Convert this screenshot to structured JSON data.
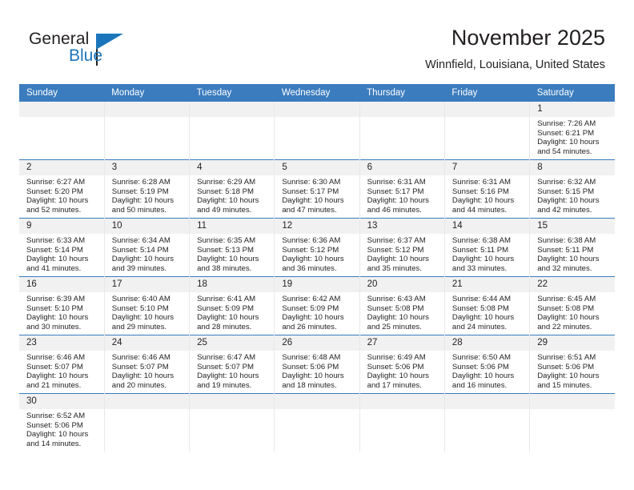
{
  "brand": {
    "name_top": "General",
    "name_bottom": "Blue",
    "accent_color": "#1b75bb",
    "triangle_icon": "triangle-logo-icon"
  },
  "header": {
    "title": "November 2025",
    "subtitle": "Winnfield, Louisiana, United States"
  },
  "calendar": {
    "header_bg": "#3b7cbe",
    "daynum_bg": "#f1f1f1",
    "weekdays": [
      "Sunday",
      "Monday",
      "Tuesday",
      "Wednesday",
      "Thursday",
      "Friday",
      "Saturday"
    ],
    "labels": {
      "sunrise": "Sunrise:",
      "sunset": "Sunset:",
      "daylight": "Daylight:"
    },
    "weeks": [
      [
        {
          "day": "",
          "empty": true
        },
        {
          "day": "",
          "empty": true
        },
        {
          "day": "",
          "empty": true
        },
        {
          "day": "",
          "empty": true
        },
        {
          "day": "",
          "empty": true
        },
        {
          "day": "",
          "empty": true
        },
        {
          "day": "1",
          "sunrise": "Sunrise: 7:26 AM",
          "sunset": "Sunset: 6:21 PM",
          "daylight_1": "Daylight: 10 hours",
          "daylight_2": "and 54 minutes."
        }
      ],
      [
        {
          "day": "2",
          "sunrise": "Sunrise: 6:27 AM",
          "sunset": "Sunset: 5:20 PM",
          "daylight_1": "Daylight: 10 hours",
          "daylight_2": "and 52 minutes."
        },
        {
          "day": "3",
          "sunrise": "Sunrise: 6:28 AM",
          "sunset": "Sunset: 5:19 PM",
          "daylight_1": "Daylight: 10 hours",
          "daylight_2": "and 50 minutes."
        },
        {
          "day": "4",
          "sunrise": "Sunrise: 6:29 AM",
          "sunset": "Sunset: 5:18 PM",
          "daylight_1": "Daylight: 10 hours",
          "daylight_2": "and 49 minutes."
        },
        {
          "day": "5",
          "sunrise": "Sunrise: 6:30 AM",
          "sunset": "Sunset: 5:17 PM",
          "daylight_1": "Daylight: 10 hours",
          "daylight_2": "and 47 minutes."
        },
        {
          "day": "6",
          "sunrise": "Sunrise: 6:31 AM",
          "sunset": "Sunset: 5:17 PM",
          "daylight_1": "Daylight: 10 hours",
          "daylight_2": "and 46 minutes."
        },
        {
          "day": "7",
          "sunrise": "Sunrise: 6:31 AM",
          "sunset": "Sunset: 5:16 PM",
          "daylight_1": "Daylight: 10 hours",
          "daylight_2": "and 44 minutes."
        },
        {
          "day": "8",
          "sunrise": "Sunrise: 6:32 AM",
          "sunset": "Sunset: 5:15 PM",
          "daylight_1": "Daylight: 10 hours",
          "daylight_2": "and 42 minutes."
        }
      ],
      [
        {
          "day": "9",
          "sunrise": "Sunrise: 6:33 AM",
          "sunset": "Sunset: 5:14 PM",
          "daylight_1": "Daylight: 10 hours",
          "daylight_2": "and 41 minutes."
        },
        {
          "day": "10",
          "sunrise": "Sunrise: 6:34 AM",
          "sunset": "Sunset: 5:14 PM",
          "daylight_1": "Daylight: 10 hours",
          "daylight_2": "and 39 minutes."
        },
        {
          "day": "11",
          "sunrise": "Sunrise: 6:35 AM",
          "sunset": "Sunset: 5:13 PM",
          "daylight_1": "Daylight: 10 hours",
          "daylight_2": "and 38 minutes."
        },
        {
          "day": "12",
          "sunrise": "Sunrise: 6:36 AM",
          "sunset": "Sunset: 5:12 PM",
          "daylight_1": "Daylight: 10 hours",
          "daylight_2": "and 36 minutes."
        },
        {
          "day": "13",
          "sunrise": "Sunrise: 6:37 AM",
          "sunset": "Sunset: 5:12 PM",
          "daylight_1": "Daylight: 10 hours",
          "daylight_2": "and 35 minutes."
        },
        {
          "day": "14",
          "sunrise": "Sunrise: 6:38 AM",
          "sunset": "Sunset: 5:11 PM",
          "daylight_1": "Daylight: 10 hours",
          "daylight_2": "and 33 minutes."
        },
        {
          "day": "15",
          "sunrise": "Sunrise: 6:38 AM",
          "sunset": "Sunset: 5:11 PM",
          "daylight_1": "Daylight: 10 hours",
          "daylight_2": "and 32 minutes."
        }
      ],
      [
        {
          "day": "16",
          "sunrise": "Sunrise: 6:39 AM",
          "sunset": "Sunset: 5:10 PM",
          "daylight_1": "Daylight: 10 hours",
          "daylight_2": "and 30 minutes."
        },
        {
          "day": "17",
          "sunrise": "Sunrise: 6:40 AM",
          "sunset": "Sunset: 5:10 PM",
          "daylight_1": "Daylight: 10 hours",
          "daylight_2": "and 29 minutes."
        },
        {
          "day": "18",
          "sunrise": "Sunrise: 6:41 AM",
          "sunset": "Sunset: 5:09 PM",
          "daylight_1": "Daylight: 10 hours",
          "daylight_2": "and 28 minutes."
        },
        {
          "day": "19",
          "sunrise": "Sunrise: 6:42 AM",
          "sunset": "Sunset: 5:09 PM",
          "daylight_1": "Daylight: 10 hours",
          "daylight_2": "and 26 minutes."
        },
        {
          "day": "20",
          "sunrise": "Sunrise: 6:43 AM",
          "sunset": "Sunset: 5:08 PM",
          "daylight_1": "Daylight: 10 hours",
          "daylight_2": "and 25 minutes."
        },
        {
          "day": "21",
          "sunrise": "Sunrise: 6:44 AM",
          "sunset": "Sunset: 5:08 PM",
          "daylight_1": "Daylight: 10 hours",
          "daylight_2": "and 24 minutes."
        },
        {
          "day": "22",
          "sunrise": "Sunrise: 6:45 AM",
          "sunset": "Sunset: 5:08 PM",
          "daylight_1": "Daylight: 10 hours",
          "daylight_2": "and 22 minutes."
        }
      ],
      [
        {
          "day": "23",
          "sunrise": "Sunrise: 6:46 AM",
          "sunset": "Sunset: 5:07 PM",
          "daylight_1": "Daylight: 10 hours",
          "daylight_2": "and 21 minutes."
        },
        {
          "day": "24",
          "sunrise": "Sunrise: 6:46 AM",
          "sunset": "Sunset: 5:07 PM",
          "daylight_1": "Daylight: 10 hours",
          "daylight_2": "and 20 minutes."
        },
        {
          "day": "25",
          "sunrise": "Sunrise: 6:47 AM",
          "sunset": "Sunset: 5:07 PM",
          "daylight_1": "Daylight: 10 hours",
          "daylight_2": "and 19 minutes."
        },
        {
          "day": "26",
          "sunrise": "Sunrise: 6:48 AM",
          "sunset": "Sunset: 5:06 PM",
          "daylight_1": "Daylight: 10 hours",
          "daylight_2": "and 18 minutes."
        },
        {
          "day": "27",
          "sunrise": "Sunrise: 6:49 AM",
          "sunset": "Sunset: 5:06 PM",
          "daylight_1": "Daylight: 10 hours",
          "daylight_2": "and 17 minutes."
        },
        {
          "day": "28",
          "sunrise": "Sunrise: 6:50 AM",
          "sunset": "Sunset: 5:06 PM",
          "daylight_1": "Daylight: 10 hours",
          "daylight_2": "and 16 minutes."
        },
        {
          "day": "29",
          "sunrise": "Sunrise: 6:51 AM",
          "sunset": "Sunset: 5:06 PM",
          "daylight_1": "Daylight: 10 hours",
          "daylight_2": "and 15 minutes."
        }
      ],
      [
        {
          "day": "30",
          "sunrise": "Sunrise: 6:52 AM",
          "sunset": "Sunset: 5:06 PM",
          "daylight_1": "Daylight: 10 hours",
          "daylight_2": "and 14 minutes."
        },
        {
          "day": "",
          "empty": true
        },
        {
          "day": "",
          "empty": true
        },
        {
          "day": "",
          "empty": true
        },
        {
          "day": "",
          "empty": true
        },
        {
          "day": "",
          "empty": true
        },
        {
          "day": "",
          "empty": true
        }
      ]
    ]
  }
}
